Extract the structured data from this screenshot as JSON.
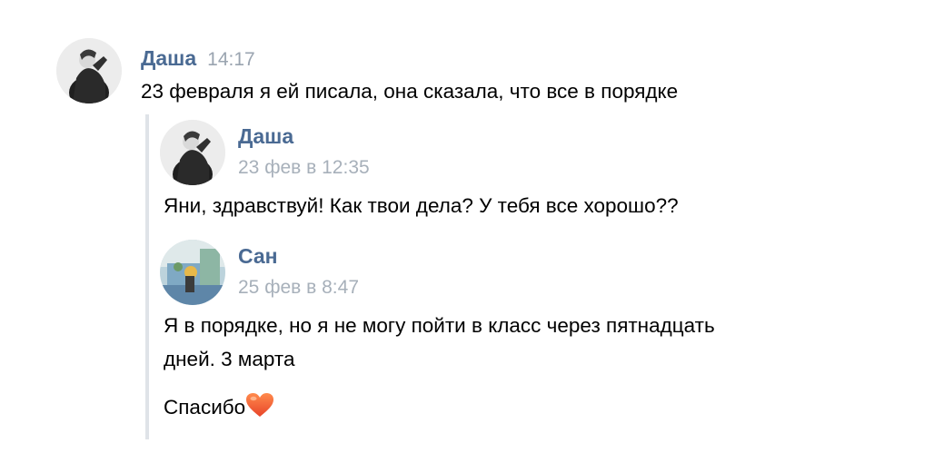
{
  "message": {
    "author": "Даша",
    "time": "14:17",
    "text": "23 февраля я ей писала, она сказала, что все в порядке"
  },
  "forwarded": [
    {
      "author": "Даша",
      "date": "23 фев в 12:35",
      "text": "Яни, здравствуй! Как твои дела? У тебя все хорошо??"
    },
    {
      "author": "Сан",
      "date": "25 фев в 8:47",
      "text_line1": "Я в порядке, но я не могу пойти в класс через пятнадцать",
      "text_line2": "дней. 3 марта",
      "text_line3": "Спасибо",
      "emoji": "heart-emoji"
    }
  ],
  "colors": {
    "author": "#4a6a93",
    "time": "#9aa4b0",
    "quote_bar": "#dfe3e8",
    "heart": "#f26d3d"
  }
}
